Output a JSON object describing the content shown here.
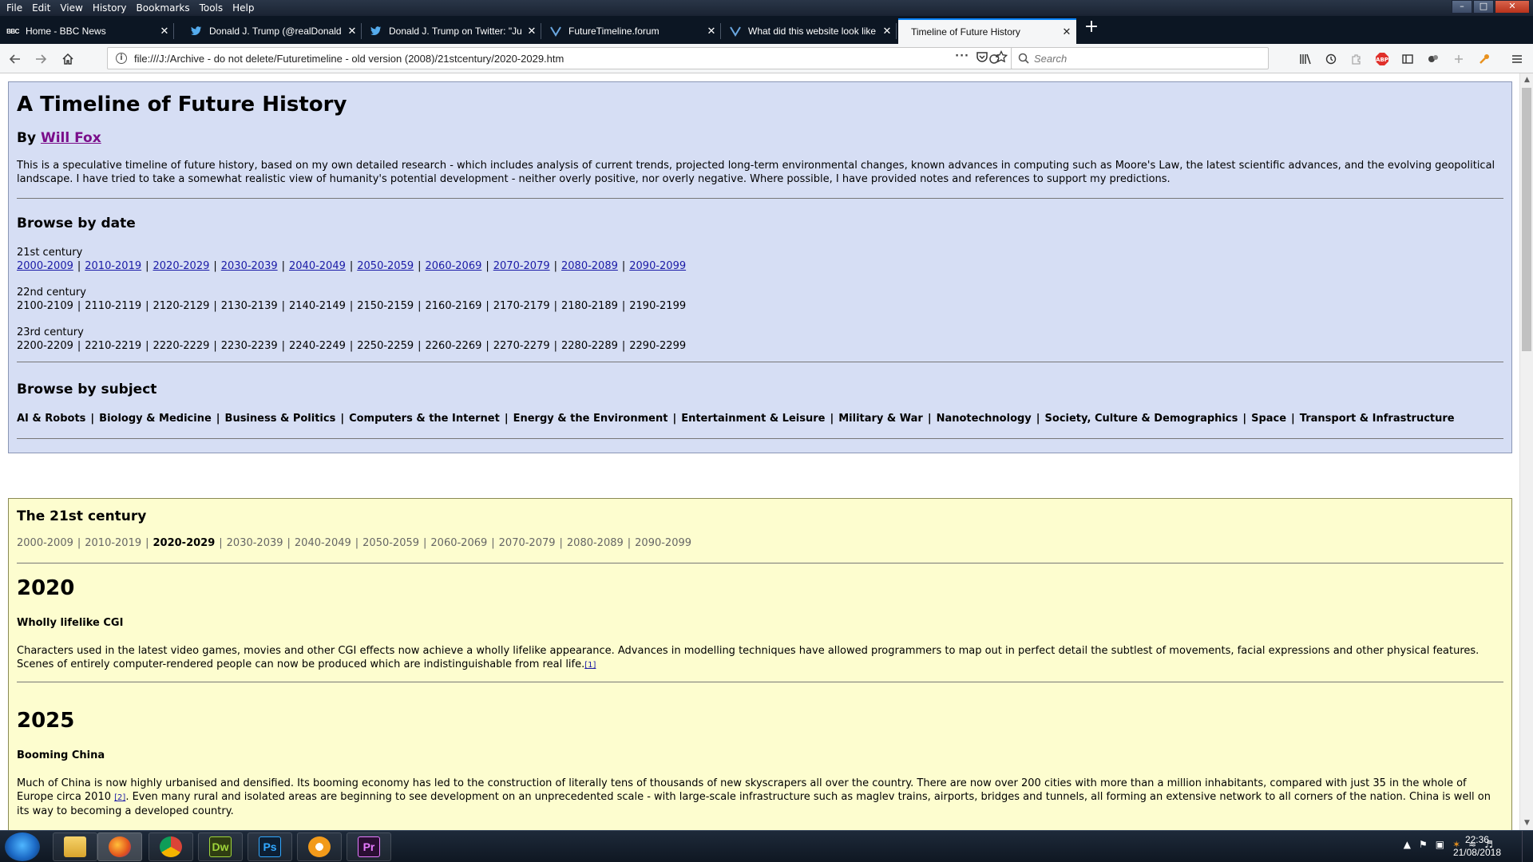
{
  "menu": [
    "File",
    "Edit",
    "View",
    "History",
    "Bookmarks",
    "Tools",
    "Help"
  ],
  "tabs": [
    {
      "label": "Home - BBC News",
      "icon": "bbc-icon"
    },
    {
      "label": "Donald J. Trump (@realDonald",
      "icon": "twitter-icon"
    },
    {
      "label": "Donald J. Trump on Twitter: \"Ju",
      "icon": "twitter-icon"
    },
    {
      "label": "FutureTimeline.forum",
      "icon": "futuretimeline-icon"
    },
    {
      "label": "What did this website look like",
      "icon": "futuretimeline-icon"
    },
    {
      "label": "Timeline of Future History",
      "icon": "",
      "active": true
    }
  ],
  "nav": {
    "url": "file:///J:/Archive - do not delete/Futuretimeline - old version (2008)/21stcentury/2020-2029.htm",
    "search_placeholder": "Search"
  },
  "page": {
    "title": "A Timeline of Future History",
    "by_prefix": "By",
    "author": "Will Fox",
    "intro": "This is a speculative timeline of future history, based on my own detailed research - which includes analysis of current trends, projected long-term environmental changes, known advances in computing such as Moore's Law, the latest scientific advances, and the evolving geopolitical landscape. I have tried to take a somewhat realistic view of humanity's potential development - neither overly positive, nor overly negative. Where possible, I have provided notes and references to support my predictions.",
    "browse_by_date": "Browse by date",
    "centuries": [
      {
        "name": "21st century",
        "linked": true,
        "decades": [
          "2000-2009",
          "2010-2019",
          "2020-2029",
          "2030-2039",
          "2040-2049",
          "2050-2059",
          "2060-2069",
          "2070-2079",
          "2080-2089",
          "2090-2099"
        ]
      },
      {
        "name": "22nd century",
        "linked": false,
        "decades": [
          "2100-2109",
          "2110-2119",
          "2120-2129",
          "2130-2139",
          "2140-2149",
          "2150-2159",
          "2160-2169",
          "2170-2179",
          "2180-2189",
          "2190-2199"
        ]
      },
      {
        "name": "23rd century",
        "linked": false,
        "decades": [
          "2200-2209",
          "2210-2219",
          "2220-2229",
          "2230-2239",
          "2240-2249",
          "2250-2259",
          "2260-2269",
          "2270-2279",
          "2280-2289",
          "2290-2299"
        ]
      }
    ],
    "browse_by_subject": "Browse by subject",
    "subjects": [
      "AI & Robots",
      "Biology & Medicine",
      "Business & Politics",
      "Computers & the Internet",
      "Energy & the Environment",
      "Entertainment & Leisure",
      "Military & War",
      "Nanotechnology",
      "Society, Culture & Demographics",
      "Space",
      "Transport & Infrastructure"
    ]
  },
  "section": {
    "title": "The 21st century",
    "decades": [
      "2000-2009",
      "2010-2019",
      "2020-2029",
      "2030-2039",
      "2040-2049",
      "2050-2059",
      "2060-2069",
      "2070-2079",
      "2080-2089",
      "2090-2099"
    ],
    "current": "2020-2029",
    "entries": [
      {
        "year": "2020",
        "title": "Wholly lifelike CGI",
        "text": "Characters used in the latest video games, movies and other CGI effects now achieve a wholly lifelike appearance. Advances in modelling techniques have allowed programmers to map out in perfect detail the subtlest of movements, facial expressions and other physical features. Scenes of entirely computer-rendered people can now be produced which are indistinguishable from real life.",
        "ref": "[1]"
      },
      {
        "year": "2025",
        "title": "Booming China",
        "text_a": "Much of China is now highly urbanised and densified. Its booming economy has led to the construction of literally tens of thousands of new skyscrapers all over the country. There are now over 200 cities with more than a million inhabitants, compared with just 35 in the whole of Europe circa 2010 ",
        "ref": "[2]",
        "text_b": ". Even many rural and isolated areas are beginning to see development on an unprecedented scale - with large-scale infrastructure such as maglev trains, airports, bridges and tunnels, all forming an extensive network to all corners of the nation. China is well on its way to becoming a developed country."
      }
    ]
  },
  "taskbar": {
    "apps": [
      {
        "name": "file-explorer",
        "label": ""
      },
      {
        "name": "firefox",
        "label": ""
      },
      {
        "name": "chrome",
        "label": ""
      },
      {
        "name": "dreamweaver",
        "label": "Dw"
      },
      {
        "name": "photoshop",
        "label": "Ps"
      },
      {
        "name": "settings",
        "label": ""
      },
      {
        "name": "premiere",
        "label": "Pr"
      }
    ],
    "time": "22:36",
    "date": "21/08/2018"
  }
}
